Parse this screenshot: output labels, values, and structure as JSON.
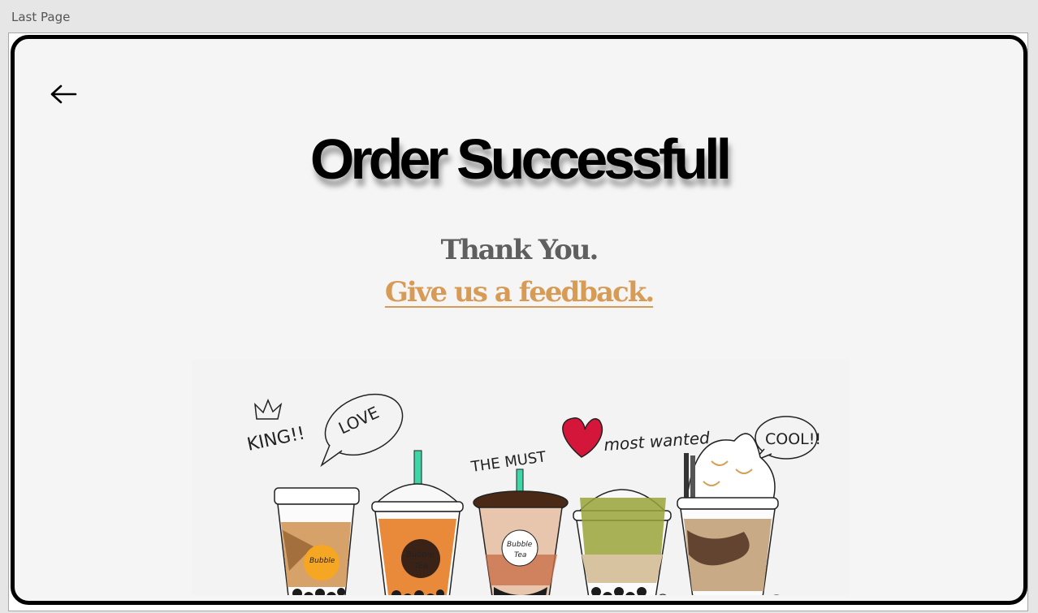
{
  "window": {
    "title": "Last Page"
  },
  "page": {
    "heading": "Order Successfull",
    "thanks": "Thank You.",
    "feedback_link": "Give us a feedback."
  },
  "illustration": {
    "doodles": [
      "KING!!",
      "LOVE",
      "THE MUST",
      "most wanted",
      "COOL!!"
    ],
    "cup_label_lines": [
      "Bubble",
      "Tea"
    ]
  },
  "colors": {
    "feedback_link": "#d79b55",
    "thanks_text": "#5f5f5f",
    "card_background": "#f5f5f5"
  },
  "icons": {
    "back": "arrow-left-icon"
  }
}
